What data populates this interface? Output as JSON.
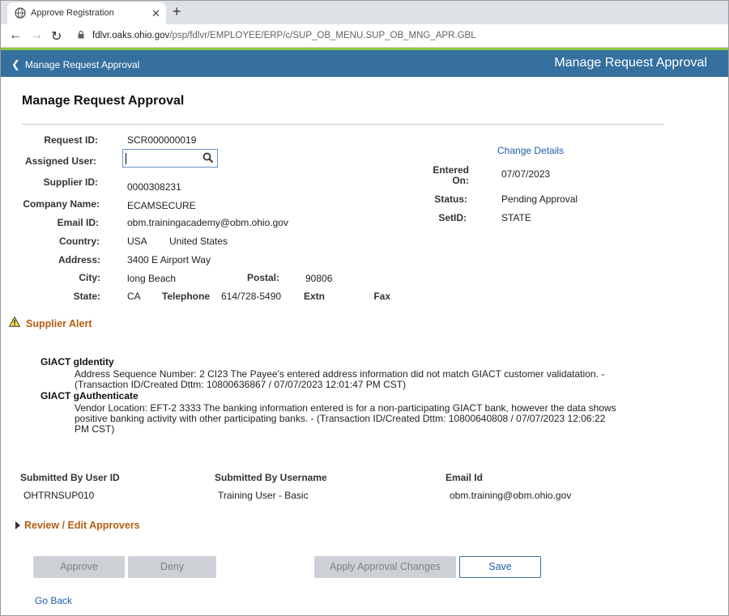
{
  "browser": {
    "tab_title": "Approve Registration",
    "tab_close": "✕",
    "new_tab": "+",
    "url_host": "fdlvr.oaks.ohio.gov",
    "url_path": "/psp/fdlvr/EMPLOYEE/ERP/c/SUP_OB_MENU.SUP_OB_MNG_APR.GBL"
  },
  "banner": {
    "back_label": "Manage Request Approval",
    "title": "Manage Request Approval",
    "color": "#35709f"
  },
  "page": {
    "title": "Manage Request Approval"
  },
  "form": {
    "request_id_label": "Request ID:",
    "request_id": "SCR000000019",
    "assigned_user_label": "Assigned User:",
    "assigned_user_value": "",
    "supplier_id_label": "Supplier ID:",
    "supplier_id": "0000308231",
    "company_name_label": "Company Name:",
    "company_name": "ECAMSECURE",
    "email_id_label": "Email ID:",
    "email_id": "obm.trainingacademy@obm.ohio.gov",
    "country_label": "Country:",
    "country_code": "USA",
    "country_name": "United States",
    "address_label": "Address:",
    "address": "3400 E Airport Way",
    "city_label": "City:",
    "city": "long Beach",
    "postal_label": "Postal:",
    "postal": "90806",
    "state_label": "State:",
    "state": "CA",
    "telephone_label": "Telephone",
    "telephone": "614/728-5490",
    "extn_label": "Extn",
    "fax_label": "Fax"
  },
  "details": {
    "change_details_link": "Change Details",
    "entered_on_label_1": "Entered",
    "entered_on_label_2": "On:",
    "entered_on": "07/07/2023",
    "status_label": "Status:",
    "status": "Pending Approval",
    "setid_label": "SetID:",
    "setid": "STATE"
  },
  "alert": {
    "title": "Supplier Alert",
    "items": [
      {
        "heading": "GIACT gIdentity",
        "line1": "Address Sequence Number: 2 CI23 The Payee's entered address information did not match GIACT customer validatation. -",
        "line2": "(Transaction ID/Created Dttm: 10800636867 / 07/07/2023 12:01:47 PM CST)"
      },
      {
        "heading": "GIACT gAuthenticate",
        "line1": "Vendor Location: EFT-2 3333 The banking information entered is for a non-participating GIACT bank, however the data shows",
        "line2": "positive banking activity with other participating banks. - (Transaction ID/Created Dttm: 10800640808 / 07/07/2023 12:06:22",
        "line3": "PM CST)"
      }
    ]
  },
  "submitted": {
    "user_id_label": "Submitted By User ID",
    "user_id": "OHTRNSUP010",
    "username_label": "Submitted By Username",
    "username": "Training User - Basic",
    "email_label": "Email Id",
    "email": "obm.training@obm.ohio.gov"
  },
  "review": {
    "title": "Review / Edit Approvers"
  },
  "buttons": {
    "approve": "Approve",
    "deny": "Deny",
    "apply_changes": "Apply Approval Changes",
    "save": "Save"
  },
  "go_back": "Go Back"
}
